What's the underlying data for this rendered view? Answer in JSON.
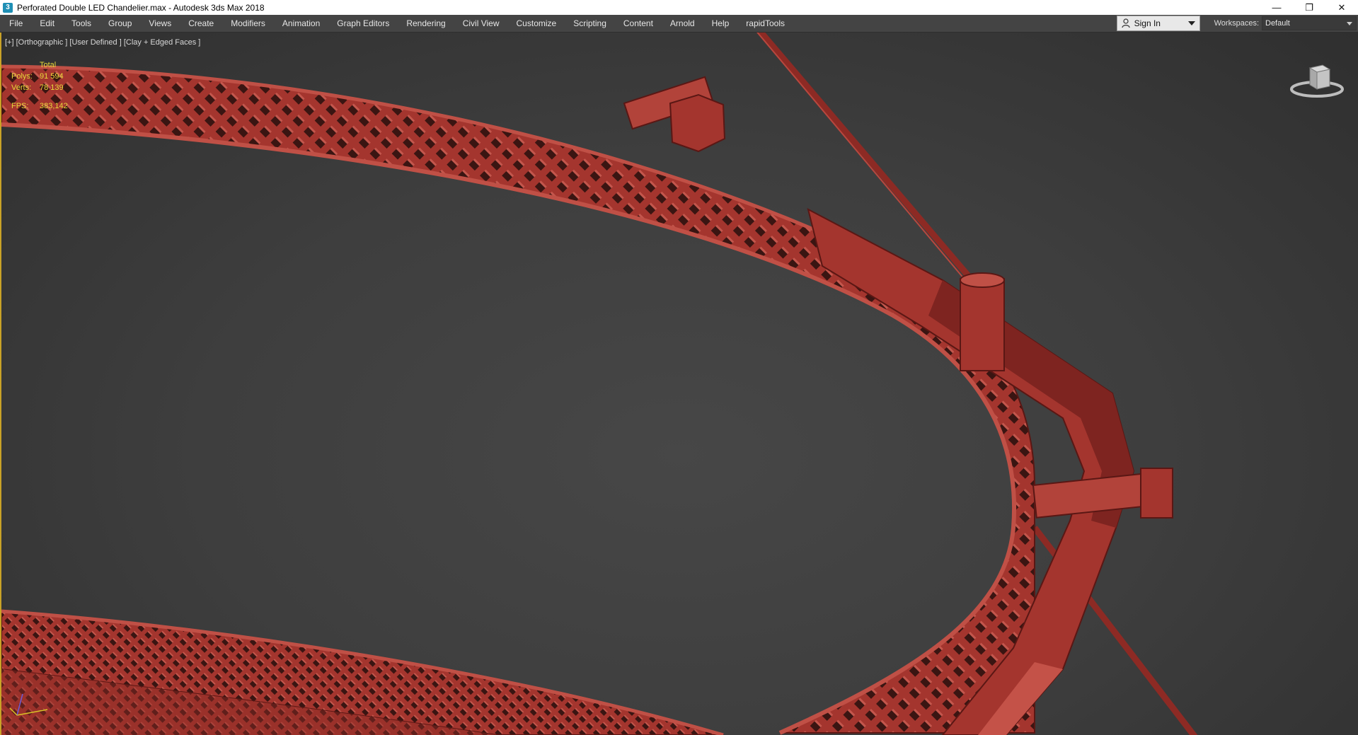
{
  "window": {
    "title": "Perforated Double LED Chandelier.max - Autodesk 3ds Max 2018",
    "icon": "3dsmax-app-icon",
    "controls": {
      "minimize": "—",
      "restore": "❐",
      "close": "✕"
    }
  },
  "menu": {
    "items": [
      "File",
      "Edit",
      "Tools",
      "Group",
      "Views",
      "Create",
      "Modifiers",
      "Animation",
      "Graph Editors",
      "Rendering",
      "Civil View",
      "Customize",
      "Scripting",
      "Content",
      "Arnold",
      "Help",
      "rapidTools"
    ]
  },
  "account": {
    "sign_in_label": "Sign In"
  },
  "workspaces": {
    "label": "Workspaces:",
    "value": "Default"
  },
  "viewport": {
    "label": "[+] [Orthographic ] [User Defined ] [Clay + Edged Faces ]",
    "stats": {
      "header": "Total",
      "polys_label": "Polys:",
      "polys_value": "91 594",
      "verts_label": "Verts:",
      "verts_value": "78 139",
      "fps_label": "FPS:",
      "fps_value": "383,142"
    }
  },
  "colors": {
    "model": "#a4352e",
    "model_dark": "#6e1c18",
    "model_light": "#c4574d",
    "viewport_bg": "#444444",
    "stats_text": "#e8d93a"
  }
}
